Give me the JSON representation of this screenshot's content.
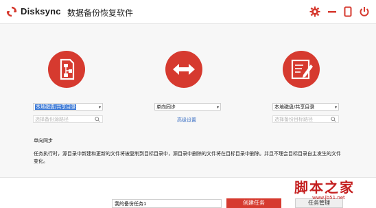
{
  "app": {
    "brand": "Disksync",
    "subtitle": "数据备份恢复软件"
  },
  "titlebar": {
    "buttons": [
      "gear-icon",
      "minimize-icon",
      "phone-icon",
      "power-icon"
    ]
  },
  "colors": {
    "accent": "#d63a2f",
    "link": "#3a6fc4"
  },
  "source": {
    "type_value": "本地磁盘/共享目录",
    "path_placeholder": "选择备份源路径"
  },
  "mode": {
    "value": "单向同步",
    "advanced_label": "高级设置"
  },
  "target": {
    "type_value": "本地磁盘/共享目录",
    "path_placeholder": "选择备份目标路径"
  },
  "description": {
    "title": "单向同步",
    "text": "任务执行时，源目录中新建和更新的文件将被复制到目标目录中，源目录中删除的文件将在目标目录中删除。并且不理会目标目录自主发生的文件变化。"
  },
  "footer": {
    "task_name": "我的备份任务1",
    "create_label": "创建任务",
    "manage_label": "任务管理"
  },
  "watermark": {
    "big": "脚本之家",
    "small": "www.jb51.net"
  }
}
